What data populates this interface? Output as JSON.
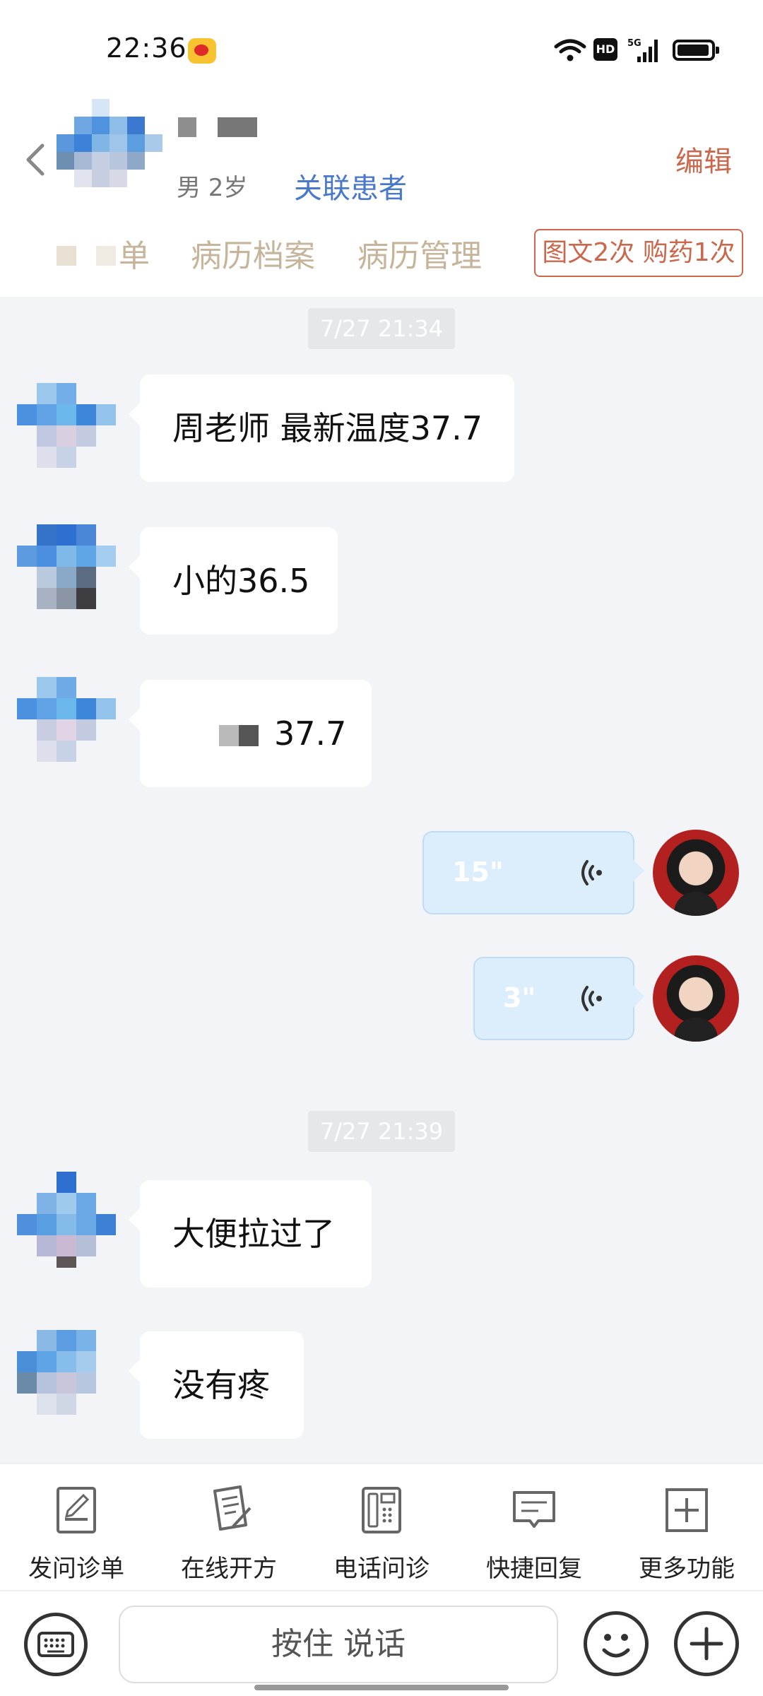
{
  "status_bar": {
    "time": "22:36",
    "hd": "HD",
    "network": "5G"
  },
  "header": {
    "patient_meta": "男 2岁",
    "link_patient": "关联患者",
    "edit": "编辑",
    "tabs": [
      "单",
      "病历档案",
      "病历管理"
    ],
    "stats": "图文2次 购药1次"
  },
  "chat": {
    "timestamps": [
      "7/27 21:34",
      "7/27 21:39"
    ],
    "messages": [
      "周老师 最新温度37.7",
      "小的36.5",
      "37.7",
      "大便拉过了",
      "没有疼"
    ],
    "voice_durations": [
      "15\"",
      "3\""
    ]
  },
  "functions": [
    "发问诊单",
    "在线开方",
    "电话问诊",
    "快捷回复",
    "更多功能"
  ],
  "input": {
    "hold_to_talk": "按住 说话"
  },
  "colors": {
    "accent": "#c9684c",
    "link": "#4b79c9",
    "tab_text": "#c6b59a",
    "voice_bubble": "#dcedfb"
  }
}
